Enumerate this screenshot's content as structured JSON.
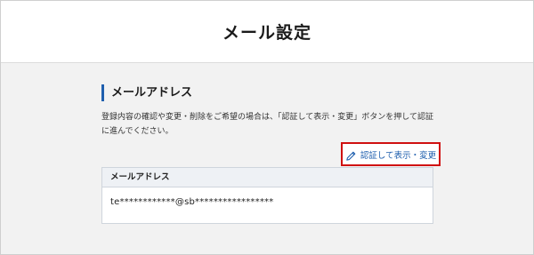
{
  "page": {
    "title": "メール設定"
  },
  "section": {
    "title": "メールアドレス",
    "description": "登録内容の確認や変更・削除をご希望の場合は、「認証して表示・変更」ボタンを押して認証に進んでください。"
  },
  "auth_button": {
    "label": "認証して表示・変更",
    "icon": "pencil-icon",
    "highlight_color": "#d01010",
    "text_color": "#1f5fae"
  },
  "email_card": {
    "header": "メールアドレス",
    "value": "te************@sb*****************"
  },
  "colors": {
    "accent": "#1f5fae",
    "background": "#f2f2f2"
  }
}
